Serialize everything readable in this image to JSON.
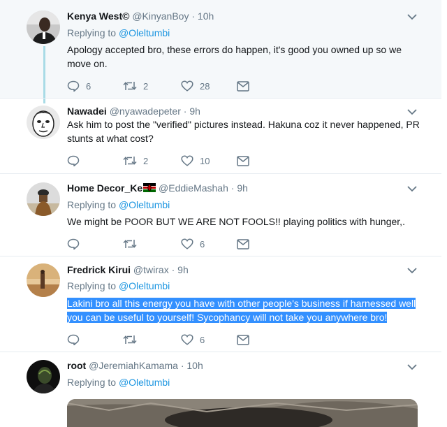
{
  "tweets": [
    {
      "name": "Kenya West©",
      "handle": "@KinyanBoy",
      "time": "10h",
      "replying_label": "Replying to",
      "replying_to": "@Oleltumbi",
      "text": "Apology accepted bro, these errors do happen, it's good you owned up so we move on.",
      "replies": "6",
      "retweets": "2",
      "likes": "28"
    },
    {
      "name": "Nawadei",
      "handle": "@nyawadepeter",
      "time": "9h",
      "text": "Ask him to post the \"verified\" pictures instead. Hakuna coz it never happened, PR stunts at what cost?",
      "replies": "",
      "retweets": "2",
      "likes": "10"
    },
    {
      "name": "Home Decor_Ke",
      "handle": "@EddieMashah",
      "time": "9h",
      "replying_label": "Replying to",
      "replying_to": "@Oleltumbi",
      "text": "We might be POOR BUT WE ARE NOT FOOLS!! playing politics with hunger,.",
      "replies": "",
      "retweets": "",
      "likes": "6"
    },
    {
      "name": "Fredrick Kirui",
      "handle": "@twirax",
      "time": "9h",
      "replying_label": "Replying to",
      "replying_to": "@Oleltumbi",
      "text_line1": "Lakini bro all this energy you have with other people's business if harnessed well",
      "text_line2": "you can be useful to yourself! Sycophancy will not take you anywhere bro!",
      "replies": "",
      "retweets": "",
      "likes": "6"
    },
    {
      "name": "root",
      "handle": "@JeremiahKamama",
      "time": "10h",
      "replying_label": "Replying to",
      "replying_to": "@Oleltumbi"
    }
  ],
  "separator_dot": "·",
  "colors": {
    "link": "#1b95e0",
    "meta": "#657786",
    "thread_line": "#a8dbe6",
    "highlight_bg": "#f5f8fa",
    "selection": "#3390ff"
  },
  "icons": [
    "reply-icon",
    "retweet-icon",
    "like-icon",
    "dm-icon",
    "chevron-down-icon",
    "kenya-flag-icon"
  ]
}
